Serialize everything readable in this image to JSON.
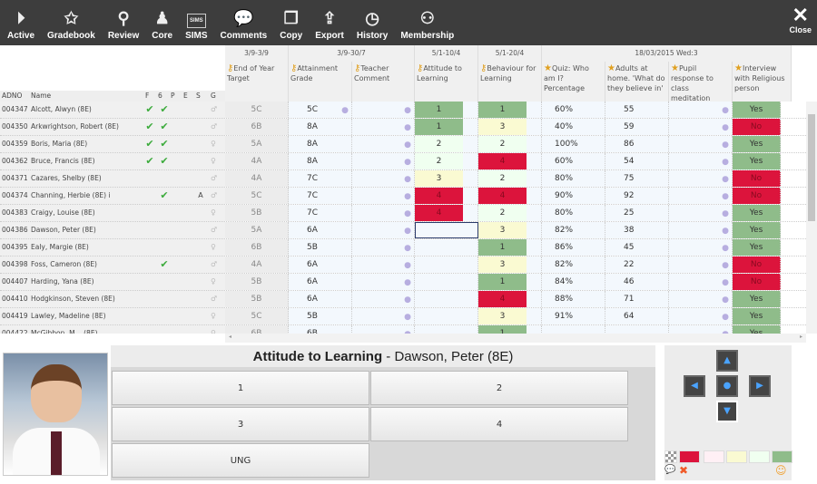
{
  "toolbar": {
    "items": [
      {
        "label": "Active",
        "icon": "funnel-icon",
        "glyph": "⏵"
      },
      {
        "label": "Gradebook",
        "icon": "star-icon",
        "glyph": "✩"
      },
      {
        "label": "Review",
        "icon": "telescope-icon",
        "glyph": "⚲"
      },
      {
        "label": "Core",
        "icon": "person-icon",
        "glyph": "♟"
      },
      {
        "label": "SIMS",
        "icon": "sims-icon",
        "glyph": "SIMS"
      },
      {
        "label": "Comments",
        "icon": "speech-bubbles-icon",
        "glyph": "💬"
      },
      {
        "label": "Copy",
        "icon": "copy-icon",
        "glyph": "❐"
      },
      {
        "label": "Export",
        "icon": "export-icon",
        "glyph": "⇪"
      },
      {
        "label": "History",
        "icon": "history-icon",
        "glyph": "◷"
      },
      {
        "label": "Membership",
        "icon": "members-icon",
        "glyph": "⚇"
      }
    ],
    "close": "Close"
  },
  "date_groups": [
    "3/9-3/9",
    "3/9-30/7",
    "5/1-10/4",
    "5/1-20/4",
    "18/03/2015 Wed:3"
  ],
  "columns": [
    "End of Year Target",
    "Attainment Grade",
    "Teacher Comment",
    "Attitude to Learning",
    "Behaviour for Learning",
    "Quiz: Who am I? Percentage",
    "Adults at home. 'What do they believe in'",
    "Pupil response to class meditation",
    "Interview with Religious person"
  ],
  "left_headers": {
    "adno": "ADNO",
    "name": "Name",
    "flags": [
      "F",
      "6",
      "P",
      "E",
      "S",
      "G"
    ]
  },
  "colors": {
    "green": "#8fbc8a",
    "red": "#dc143c",
    "yellow": "#fafad2",
    "pale_green": "#f0fff0",
    "pale_pink": "#fff0f5"
  },
  "rows": [
    {
      "adno": "004347",
      "name": "Alcott, Alwyn (8E)",
      "f": "✔",
      "six": "✔",
      "s": "",
      "gender": "♂",
      "target": "5C",
      "attain": "5C",
      "att": "1",
      "att_c": "green",
      "beh": "1",
      "beh_c": "green",
      "quiz": "60%",
      "adults": "55",
      "interview": "Yes"
    },
    {
      "adno": "004350",
      "name": "Arkwrightson, Robert (8E)",
      "f": "✔",
      "six": "✔",
      "s": "",
      "gender": "♂",
      "target": "6B",
      "attain": "8A",
      "att": "1",
      "att_c": "green",
      "beh": "3",
      "beh_c": "yellow",
      "quiz": "40%",
      "adults": "59",
      "interview": "No"
    },
    {
      "adno": "004359",
      "name": "Boris, Maria (8E)",
      "f": "✔",
      "six": "✔",
      "s": "",
      "gender": "♀",
      "target": "5A",
      "attain": "8A",
      "att": "2",
      "att_c": "pg",
      "beh": "2",
      "beh_c": "pg",
      "quiz": "100%",
      "adults": "86",
      "interview": "Yes"
    },
    {
      "adno": "004362",
      "name": "Bruce, Francis (8E)",
      "f": "✔",
      "six": "✔",
      "s": "",
      "gender": "♀",
      "target": "4A",
      "attain": "8A",
      "att": "2",
      "att_c": "pg",
      "beh": "4",
      "beh_c": "red",
      "quiz": "60%",
      "adults": "54",
      "interview": "Yes"
    },
    {
      "adno": "004371",
      "name": "Cazares, Shelby (8E)",
      "f": "",
      "six": "",
      "s": "",
      "gender": "♂",
      "target": "4A",
      "attain": "7C",
      "att": "3",
      "att_c": "yellow",
      "beh": "2",
      "beh_c": "pg",
      "quiz": "80%",
      "adults": "75",
      "interview": "No"
    },
    {
      "adno": "004374",
      "name": "Channing, Herbie (8E) i",
      "f": "",
      "six": "✔",
      "s": "A",
      "gender": "♂",
      "target": "5C",
      "attain": "7C",
      "att": "4",
      "att_c": "red",
      "beh": "4",
      "beh_c": "red",
      "quiz": "90%",
      "adults": "92",
      "interview": "No"
    },
    {
      "adno": "004383",
      "name": "Craigy, Louise (8E)",
      "f": "",
      "six": "",
      "s": "",
      "gender": "♀",
      "target": "5B",
      "attain": "7C",
      "att": "4",
      "att_c": "red",
      "beh": "2",
      "beh_c": "pg",
      "quiz": "80%",
      "adults": "25",
      "interview": "Yes"
    },
    {
      "adno": "004386",
      "name": "Dawson, Peter (8E)",
      "f": "",
      "six": "",
      "s": "",
      "gender": "♂",
      "target": "5A",
      "attain": "6A",
      "att": "",
      "att_c": "selected",
      "beh": "3",
      "beh_c": "yellow",
      "quiz": "82%",
      "adults": "38",
      "interview": "Yes"
    },
    {
      "adno": "004395",
      "name": "Ealy, Margie (8E)",
      "f": "",
      "six": "",
      "s": "",
      "gender": "♀",
      "target": "6B",
      "attain": "5B",
      "att": "",
      "att_c": "",
      "beh": "1",
      "beh_c": "green",
      "quiz": "86%",
      "adults": "45",
      "interview": "Yes"
    },
    {
      "adno": "004398",
      "name": "Foss, Cameron (8E)",
      "f": "",
      "six": "✔",
      "s": "",
      "gender": "♂",
      "target": "4A",
      "attain": "6A",
      "att": "",
      "att_c": "",
      "beh": "3",
      "beh_c": "yellow",
      "quiz": "82%",
      "adults": "22",
      "interview": "No"
    },
    {
      "adno": "004407",
      "name": "Harding, Yana (8E)",
      "f": "",
      "six": "",
      "s": "",
      "gender": "♀",
      "target": "5B",
      "attain": "6A",
      "att": "",
      "att_c": "",
      "beh": "1",
      "beh_c": "green",
      "quiz": "84%",
      "adults": "46",
      "interview": "No"
    },
    {
      "adno": "004410",
      "name": "Hodgkinson, Steven (8E)",
      "f": "",
      "six": "",
      "s": "",
      "gender": "♂",
      "target": "5B",
      "attain": "6A",
      "att": "",
      "att_c": "",
      "beh": "4",
      "beh_c": "red",
      "quiz": "88%",
      "adults": "71",
      "interview": "Yes"
    },
    {
      "adno": "004419",
      "name": "Lawley, Madeline (8E)",
      "f": "",
      "six": "",
      "s": "",
      "gender": "♀",
      "target": "5C",
      "attain": "5B",
      "att": "",
      "att_c": "",
      "beh": "3",
      "beh_c": "yellow",
      "quiz": "91%",
      "adults": "64",
      "interview": "Yes"
    },
    {
      "adno": "004422",
      "name": "McGibbon, M... (8E)",
      "f": "",
      "six": "",
      "s": "",
      "gender": "♀",
      "target": "6B",
      "attain": "6B",
      "att": "",
      "att_c": "",
      "beh": "1",
      "beh_c": "green",
      "quiz": "",
      "adults": "",
      "interview": "Yes"
    }
  ],
  "panel": {
    "title": "Attitude to Learning",
    "student": " - Dawson, Peter (8E)",
    "options": [
      "1",
      "2",
      "3",
      "4",
      "UNG"
    ]
  }
}
